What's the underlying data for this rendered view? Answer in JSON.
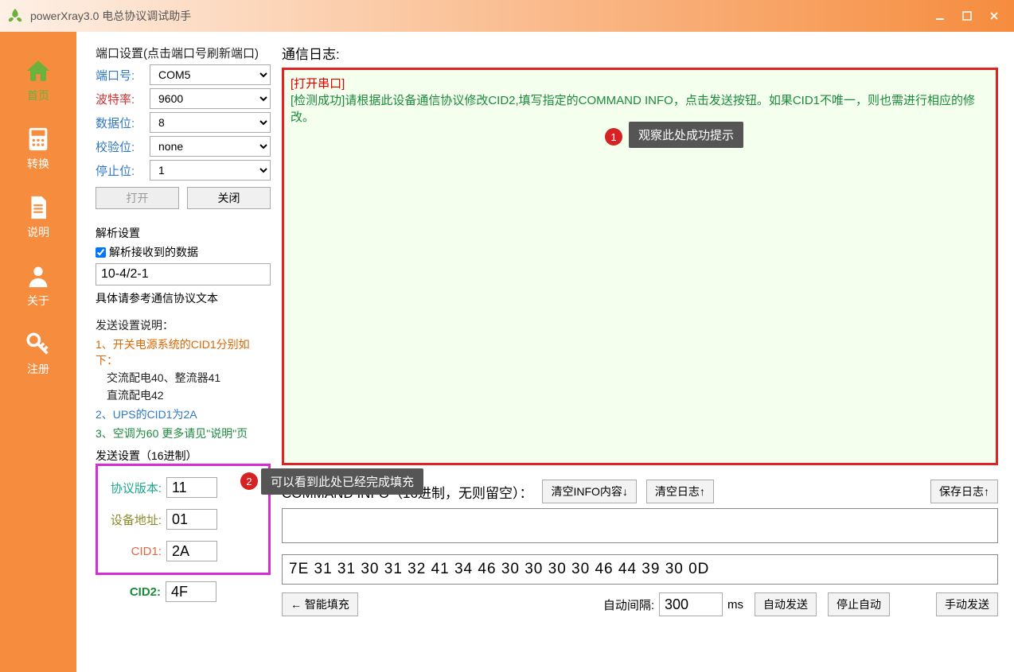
{
  "title": "powerXray3.0 电总协议调试助手",
  "sidebar": {
    "items": [
      {
        "label": "首页"
      },
      {
        "label": "转换"
      },
      {
        "label": "说明"
      },
      {
        "label": "关于"
      },
      {
        "label": "注册"
      }
    ]
  },
  "port": {
    "heading": "端口设置(点击端口号刷新端口)",
    "port_label": "端口号:",
    "port_value": "COM5",
    "baud_label": "波特率:",
    "baud_value": "9600",
    "data_label": "数据位:",
    "data_value": "8",
    "parity_label": "校验位:",
    "parity_value": "none",
    "stop_label": "停止位:",
    "stop_value": "1",
    "open_btn": "打开",
    "close_btn": "关闭"
  },
  "parse": {
    "heading": "解析设置",
    "checkbox_label": "解析接收到的数据",
    "value": "10-4/2-1",
    "hint": "具体请参考通信协议文本"
  },
  "send_desc": {
    "heading": "发送设置说明：",
    "l1": "1、开关电源系统的CID1分别如下：",
    "l1b1": "交流配电40、整流器41",
    "l1b2": "直流配电42",
    "l2": "2、UPS的CID1为2A",
    "l3": "3、空调为60  更多请见\"说明\"页"
  },
  "send_set_label": "发送设置（16进制）",
  "hex": {
    "proto_label": "协议版本:",
    "proto_value": "11",
    "addr_label": "设备地址:",
    "addr_value": "01",
    "cid1_label": "CID1:",
    "cid1_value": "2A",
    "cid2_label": "CID2:",
    "cid2_value": "4F"
  },
  "log": {
    "heading": "通信日志:",
    "line_open": "[打开串口]",
    "line_ok": "[检测成功]请根据此设备通信协议修改CID2,填写指定的COMMAND INFO，点击发送按钮。如果CID1不唯一，则也需进行相应的修改。"
  },
  "cmd": {
    "label": "COMMAND INFO（16进制，无则留空）：",
    "clear_info_btn": "清空INFO内容↓",
    "clear_log_btn": "清空日志↑",
    "save_log_btn": "保存日志↑"
  },
  "hex_out": "7E 31 31 30 31 32 41 34 46 30 30 30 30 46 44 39 30 0D",
  "bottom": {
    "smart_fill": "← 智能填充",
    "auto_interval_label": "自动间隔:",
    "auto_interval_value": "300",
    "auto_interval_unit": "ms",
    "auto_send": "自动发送",
    "stop_auto": "停止自动",
    "manual_send": "手动发送"
  },
  "annotations": {
    "tip1": "观察此处成功提示",
    "tip2": "可以看到此处已经完成填充"
  }
}
